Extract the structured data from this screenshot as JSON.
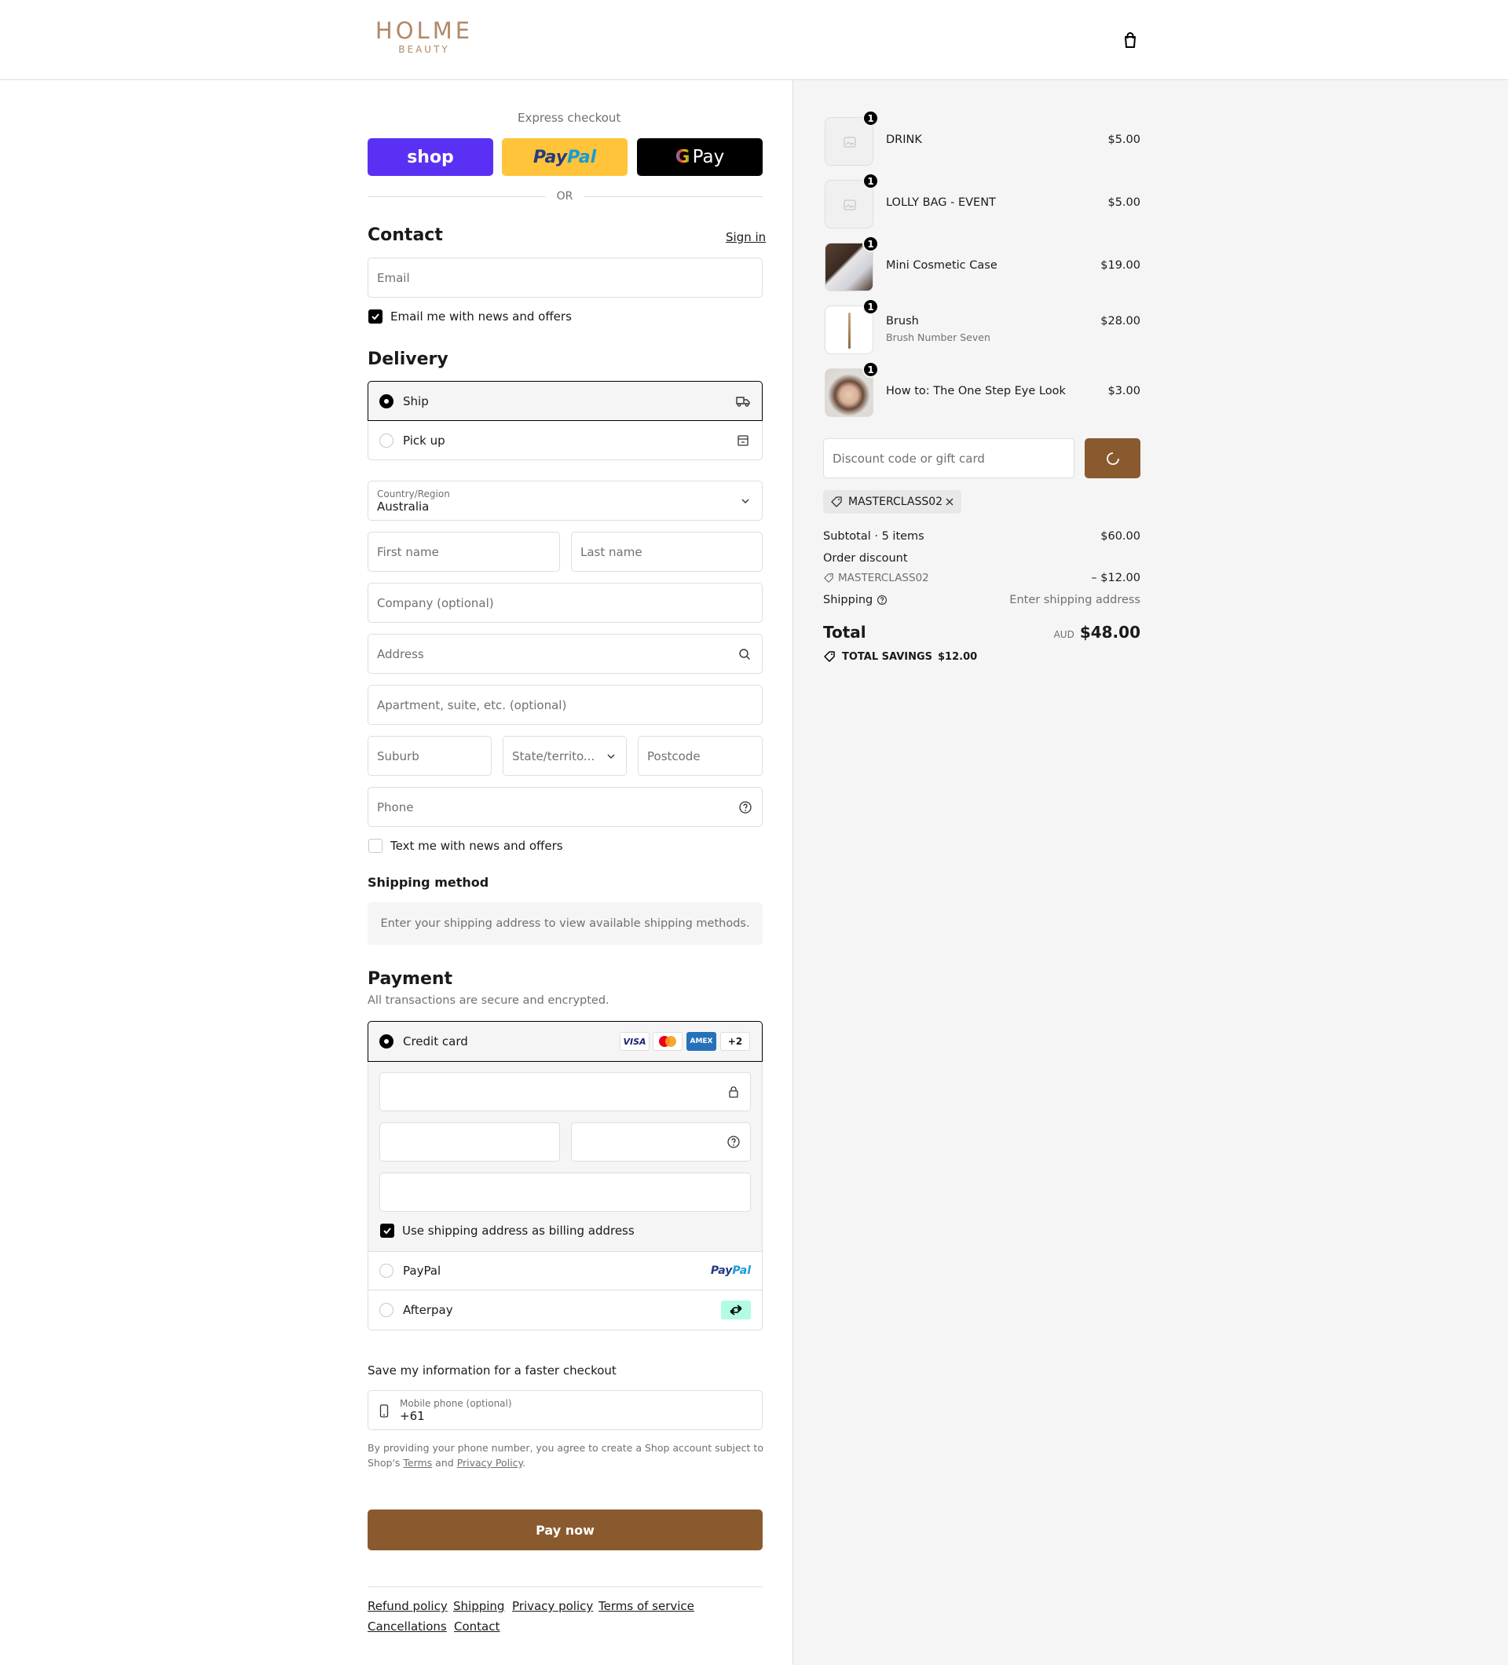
{
  "header": {
    "logo_main": "HOLME",
    "logo_sub": "BEAUTY",
    "cart_icon": "shopping-bag-icon"
  },
  "express": {
    "label": "Express checkout",
    "shop_label": "shop",
    "paypal_label_1": "Pay",
    "paypal_label_2": "Pal",
    "gpay_label": "Pay",
    "or_label": "OR"
  },
  "contact": {
    "title": "Contact",
    "sign_in": "Sign in",
    "email_placeholder": "Email",
    "news_label": "Email me with news and offers",
    "news_checked": true
  },
  "delivery": {
    "title": "Delivery",
    "ship_label": "Ship",
    "pickup_label": "Pick up",
    "country_label": "Country/Region",
    "country_value": "Australia",
    "first_name": "First name",
    "last_name": "Last name",
    "company": "Company (optional)",
    "address": "Address",
    "apartment": "Apartment, suite, etc. (optional)",
    "suburb": "Suburb",
    "state": "State/territo...",
    "postcode": "Postcode",
    "phone": "Phone",
    "text_news_label": "Text me with news and offers"
  },
  "shipping_method": {
    "title": "Shipping method",
    "message": "Enter your shipping address to view available shipping methods."
  },
  "payment": {
    "title": "Payment",
    "subtitle": "All transactions are secure and encrypted.",
    "credit_card_label": "Credit card",
    "card_logos": [
      "VISA",
      "MC",
      "AMEX"
    ],
    "more_cards": "+2",
    "billing_label": "Use shipping address as billing address",
    "paypal_label": "PayPal",
    "paypal_logo_1": "Pay",
    "paypal_logo_2": "Pal",
    "afterpay_label": "Afterpay"
  },
  "save_info": {
    "title": "Save my information for a faster checkout",
    "mobile_label": "Mobile phone (optional)",
    "mobile_value": "+61",
    "disclaimer_1": "By providing your phone number, you agree to create a Shop account subject to",
    "disclaimer_2a": "Shop's",
    "terms": "Terms",
    "and": "and",
    "privacy": "Privacy Policy",
    "period": "."
  },
  "pay_now": "Pay now",
  "footer_links": [
    "Refund policy",
    "Shipping",
    "Privacy policy",
    "Terms of service",
    "Cancellations",
    "Contact"
  ],
  "order": {
    "items": [
      {
        "name": "DRINK",
        "variant": "",
        "qty": "1",
        "price": "$5.00"
      },
      {
        "name": "LOLLY BAG - EVENT",
        "variant": "",
        "qty": "1",
        "price": "$5.00"
      },
      {
        "name": "Mini Cosmetic Case",
        "variant": "",
        "qty": "1",
        "price": "$19.00"
      },
      {
        "name": "Brush",
        "variant": "Brush Number Seven",
        "qty": "1",
        "price": "$28.00"
      },
      {
        "name": "How to: The One Step Eye Look",
        "variant": "",
        "qty": "1",
        "price": "$3.00"
      }
    ],
    "discount_placeholder": "Discount code or gift card",
    "applied_code": "MASTERCLASS02",
    "subtotal_label": "Subtotal · 5 items",
    "subtotal_value": "$60.00",
    "order_discount_label": "Order discount",
    "discount_code": "MASTERCLASS02",
    "discount_value": "– $12.00",
    "shipping_label": "Shipping",
    "shipping_value": "Enter shipping address",
    "total_label": "Total",
    "currency": "AUD",
    "total_value": "$48.00",
    "savings_label": "TOTAL SAVINGS",
    "savings_value": "$12.00"
  },
  "colors": {
    "brand": "#8a5a2f",
    "shop_purple": "#5a31f4",
    "paypal_yellow": "#ffc439"
  }
}
